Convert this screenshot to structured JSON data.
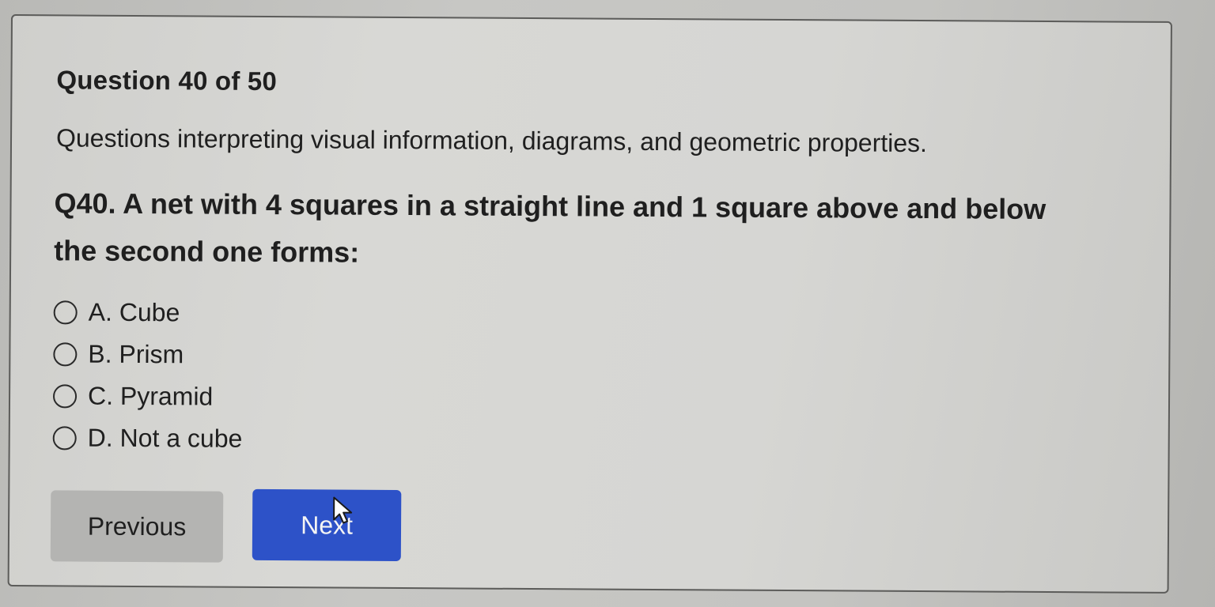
{
  "quiz": {
    "counter": "Question 40 of 50",
    "description": "Questions interpreting visual information, diagrams, and geometric properties.",
    "question": "Q40. A net with 4 squares in a straight line and 1 square above and below the second one forms:",
    "options": [
      {
        "label": "A. Cube"
      },
      {
        "label": "B. Prism"
      },
      {
        "label": "C. Pyramid"
      },
      {
        "label": "D. Not a cube"
      }
    ],
    "previous_label": "Previous",
    "next_label": "Next"
  },
  "colors": {
    "next_button": "#2d52c8",
    "previous_button": "#b4b4b2",
    "card_background": "#d6d6d3"
  },
  "icons": {
    "cursor": "mouse-pointer-icon"
  }
}
